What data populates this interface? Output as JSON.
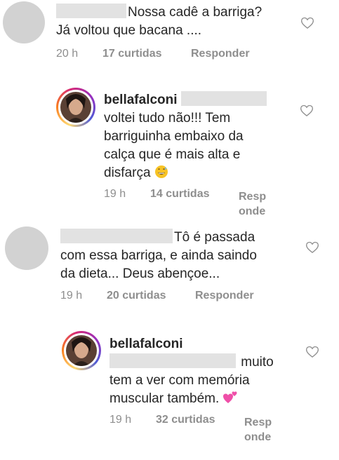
{
  "comments": [
    {
      "text_lines": [
        "Nossa cadê a barriga?",
        "Já voltou que bacana ...."
      ],
      "time": "20 h",
      "likes": "17 curtidas",
      "reply": "Responder"
    },
    {
      "username": "bellafalconi",
      "text_lines": [
        "voltei tudo não!!! Tem",
        "barriguinha embaixo da",
        "calça que é mais alta e",
        "disfarça"
      ],
      "emoji": "grinning-sweat-emoji",
      "time": "19 h",
      "likes": "14 curtidas",
      "reply_parts": [
        "Resp",
        "onde"
      ]
    },
    {
      "text_lines": [
        "Tô é passada",
        "com essa barriga, e ainda saindo",
        "da dieta... Deus abençoe..."
      ],
      "time": "19 h",
      "likes": "20 curtidas",
      "reply": "Responder"
    },
    {
      "username": "bellafalconi",
      "text_lines": [
        "muito",
        "tem a ver com memória",
        "muscular também."
      ],
      "emoji": "two-hearts-emoji",
      "time": "19 h",
      "likes": "32 curtidas",
      "reply_parts": [
        "Resp",
        "onde"
      ]
    }
  ],
  "icons": {
    "like": "heart-outline-icon"
  },
  "colors": {
    "text": "#262626",
    "meta": "#8e8e8e",
    "redaction": "#e2e2e2",
    "avatar_placeholder": "#d2d2d2"
  }
}
